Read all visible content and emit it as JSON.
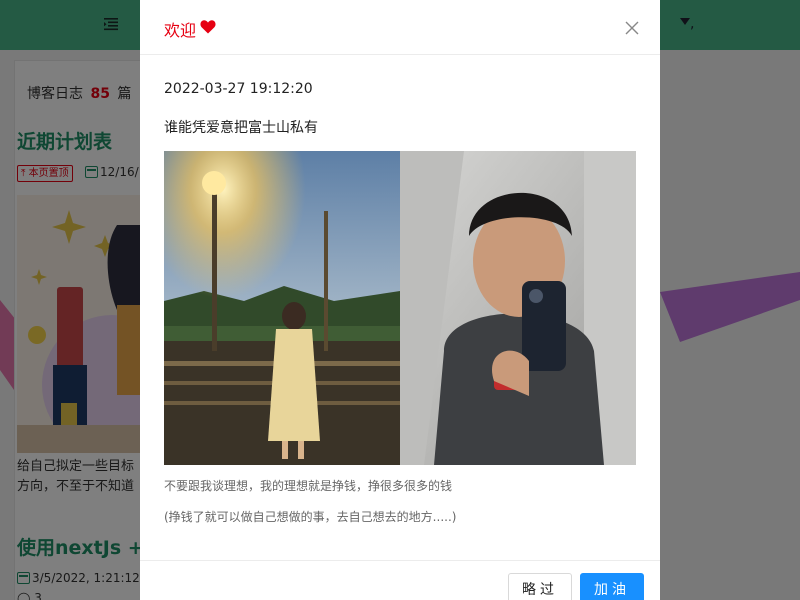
{
  "background": {
    "blog_count_prefix": "博客日志",
    "blog_count_value": "85",
    "blog_count_suffix": "篇",
    "post1_title": "近期计划表",
    "pin_tag": "本页置顶",
    "post1_date": "12/16/",
    "excerpt_line1": "给自己拟定一些目标",
    "excerpt_line2": "方向，不至于不知道",
    "post2_title": "使用nextJs + t",
    "post2_date": "3/5/2022, 1:21:12",
    "comment_count": "3",
    "topbar_comma": ","
  },
  "modal": {
    "title": "欢迎",
    "heart_color": "#e60012",
    "date": "2022-03-27 19:12:20",
    "quote": "谁能凭爱意把富士山私有",
    "caption_1": "不要跟我谈理想，我的理想就是挣钱，挣很多很多的钱",
    "caption_2": "(挣钱了就可以做自己想做的事，去自己想去的地方.....)",
    "skip_label": "略过",
    "go_label": "加油"
  },
  "colors": {
    "topbar": "#49b589",
    "accent_green": "#1f8f66",
    "primary_button": "#1890ff",
    "alert_red": "#e60012"
  }
}
